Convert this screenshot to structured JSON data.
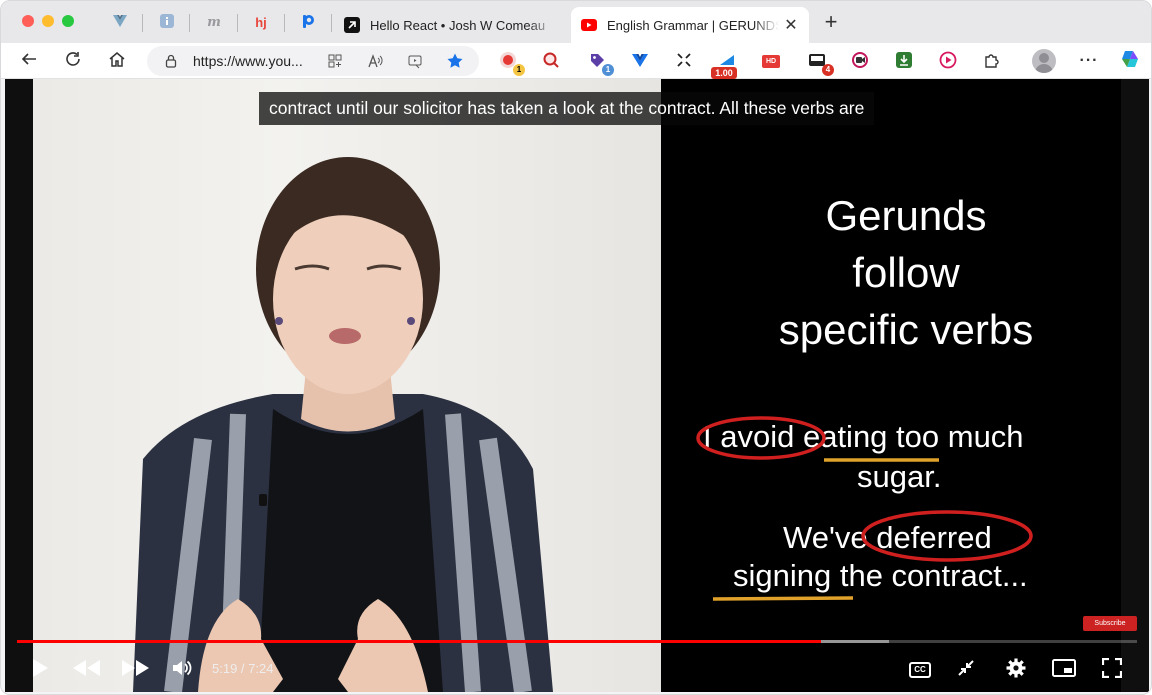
{
  "browser": {
    "tabs": [
      {
        "title": "Hello React • Josh W Comeau",
        "active": false
      },
      {
        "title": "English Grammar | GERUNDS in English",
        "active": true
      }
    ],
    "pinned_tab_icons": [
      "vuejs-devtools-icon",
      "info-icon",
      "medium-m-icon",
      "hj-icon",
      "p-logo-icon"
    ],
    "pinned_tab_labels": [
      "m",
      "hj"
    ],
    "new_tab_label": "+",
    "address": {
      "url": "https://www.you..."
    },
    "extension_badges": {
      "ext1": "1",
      "ext3": "1",
      "speed": "1.00",
      "hd": "HD",
      "ext7": "4"
    },
    "menu_label": "···",
    "colors": {
      "accent_blue": "#1a73e8",
      "youtube_red": "#ff0000"
    }
  },
  "video": {
    "caption": "contract until our solicitor has taken a look at the contract. All these verbs are",
    "slide": {
      "title_lines": [
        "Gerunds",
        "follow",
        "specific verbs"
      ],
      "ex1_circled": "I avoid",
      "ex1_rest": " eating too much",
      "ex1_line2": "sugar.",
      "ex2_a": "We've",
      "ex2_circled": "deferred",
      "ex2_line2": "signing the contract..."
    },
    "subscribe_label": "Subscribe",
    "time": "5:19 / 7:24",
    "progress_fraction": 0.718,
    "buffer_fraction": 0.779,
    "cc_label": "CC"
  }
}
